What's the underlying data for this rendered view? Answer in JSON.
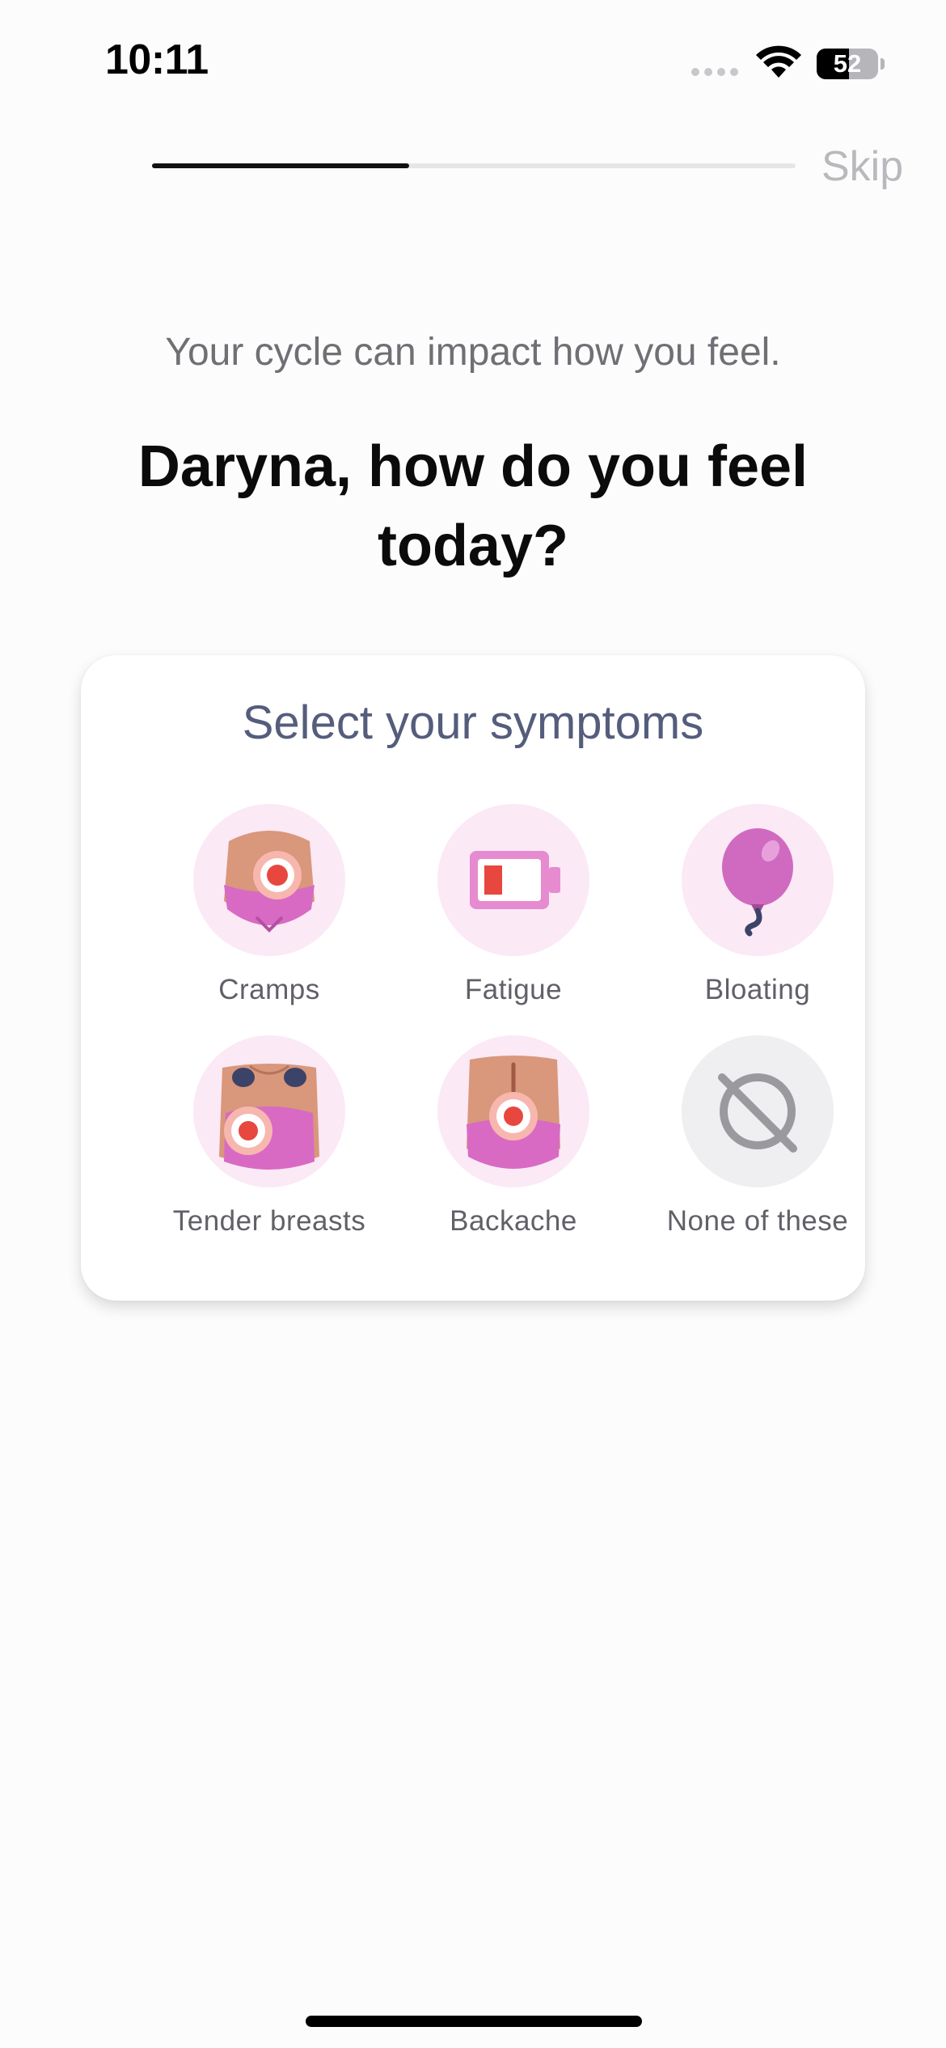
{
  "status_bar": {
    "time": "10:11",
    "battery_percent": 52,
    "battery_label": "52"
  },
  "progress": {
    "fraction": 0.4
  },
  "header": {
    "skip_label": "Skip"
  },
  "intro": {
    "subtitle": "Your cycle can impact how you feel.",
    "title": "Daryna, how do you feel today?"
  },
  "symptoms_card": {
    "title": "Select your symptoms",
    "items": [
      {
        "label": "Cramps",
        "icon": "cramps-icon"
      },
      {
        "label": "Fatigue",
        "icon": "low-battery-icon"
      },
      {
        "label": "Bloating",
        "icon": "balloon-icon"
      },
      {
        "label": "Tender breasts",
        "icon": "tender-breasts-icon"
      },
      {
        "label": "Backache",
        "icon": "backache-icon"
      },
      {
        "label": "None of these",
        "icon": "none-icon"
      }
    ]
  },
  "colors": {
    "accent_pink": "#d86ac4",
    "circle_bg": "#fbe9f5",
    "pain_red": "#e8473f",
    "skin": "#d9977b",
    "card_title": "#555d7c"
  }
}
